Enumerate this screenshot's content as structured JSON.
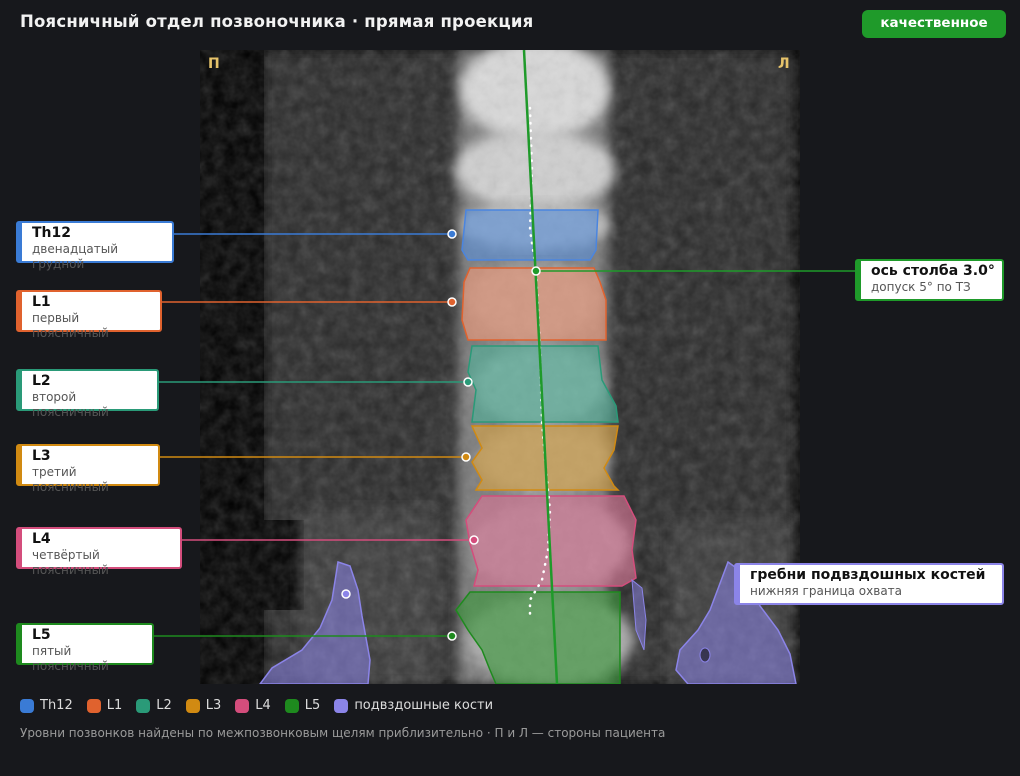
{
  "title": "Поясничный отдел позвоночника · прямая проекция",
  "quality_badge": "качественное",
  "sides": {
    "right": "П",
    "left": "Л"
  },
  "vertebrae": [
    {
      "id": "th12",
      "name": "Th12",
      "desc": "двенадцатый грудной",
      "color": "#3a7bd5"
    },
    {
      "id": "l1",
      "name": "L1",
      "desc": "первый поясничный",
      "color": "#e0622e"
    },
    {
      "id": "l2",
      "name": "L2",
      "desc": "второй поясничный",
      "color": "#2a9a78"
    },
    {
      "id": "l3",
      "name": "L3",
      "desc": "третий поясничный",
      "color": "#d18a12"
    },
    {
      "id": "l4",
      "name": "L4",
      "desc": "четвёртый поясничный",
      "color": "#d44d7c"
    },
    {
      "id": "l5",
      "name": "L5",
      "desc": "пятый поясничный",
      "color": "#1e8a1e"
    }
  ],
  "axis": {
    "name": "ось столба",
    "angle": "3.0°",
    "tolerance": "допуск 5° по ТЗ",
    "color": "#1f9a2a"
  },
  "iliac": {
    "name": "гребни подвздошных костей",
    "desc": "нижняя граница охвата",
    "color": "#8b84e8"
  },
  "legend": [
    {
      "label": "Th12",
      "color": "#3a7bd5"
    },
    {
      "label": "L1",
      "color": "#e0622e"
    },
    {
      "label": "L2",
      "color": "#2a9a78"
    },
    {
      "label": "L3",
      "color": "#d18a12"
    },
    {
      "label": "L4",
      "color": "#d44d7c"
    },
    {
      "label": "L5",
      "color": "#1e8a1e"
    },
    {
      "label": "подвздошные кости",
      "color": "#8b84e8"
    }
  ],
  "note": "Уровни позвонков найдены по межпозвонковым щелям приблизительно · П и Л — стороны пациента"
}
